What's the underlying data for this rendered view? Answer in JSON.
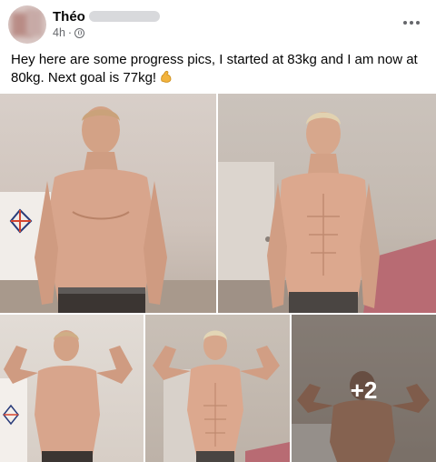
{
  "post": {
    "author": "Théo",
    "time": "4h",
    "separator": "·",
    "privacy_icon": "globe-icon",
    "more_icon": "more-options-icon",
    "text": "Hey here are some progress pics, I started at 83kg and I am now at 80kg. Next goal is 77kg!",
    "emoji_icon": "flexed-biceps-icon"
  },
  "gallery": {
    "photos": [
      {
        "alt": "progress-photo-front-before"
      },
      {
        "alt": "progress-photo-front-after"
      },
      {
        "alt": "progress-photo-flex-before"
      },
      {
        "alt": "progress-photo-flex-after"
      },
      {
        "alt": "progress-photo-back"
      }
    ],
    "more_count": "+2"
  },
  "colors": {
    "text_primary": "#050505",
    "text_secondary": "#65676b",
    "skin": "#d8a58c"
  }
}
